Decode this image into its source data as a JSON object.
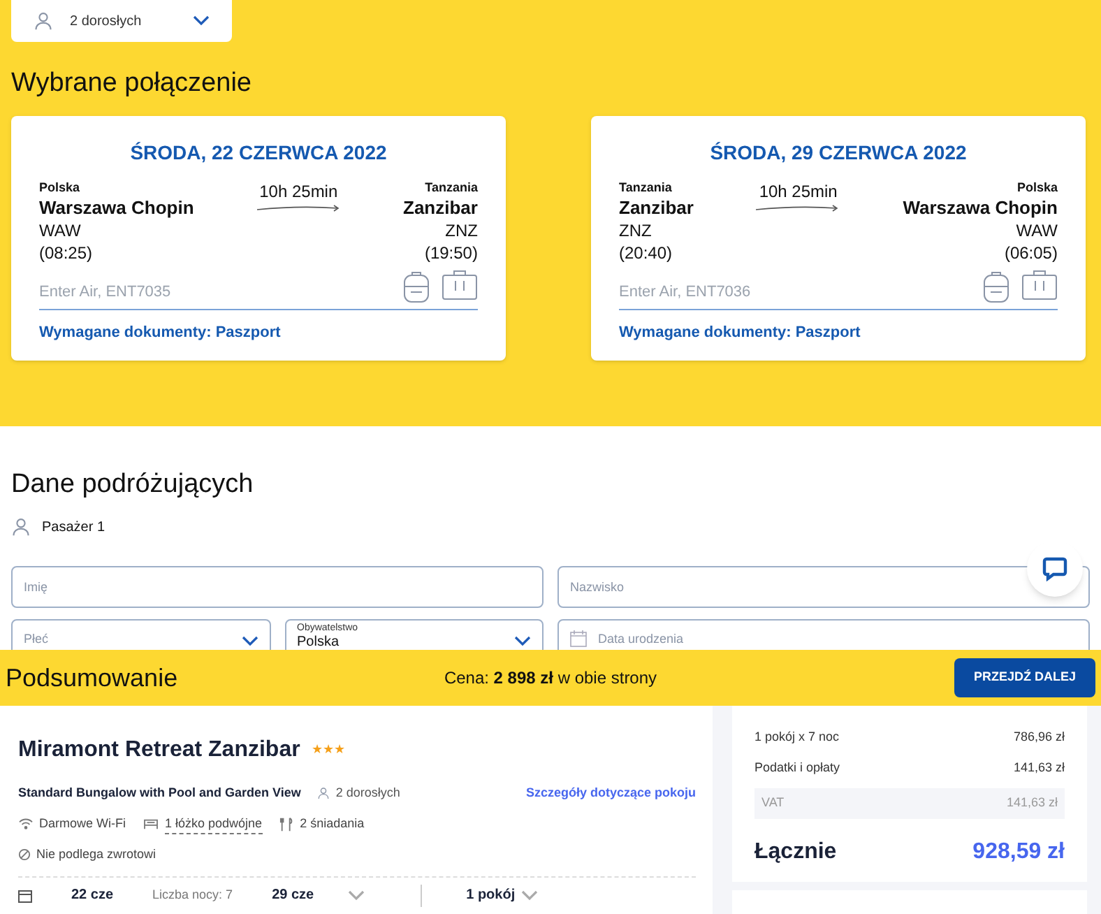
{
  "travellers_select": {
    "value": "2 dorosłych"
  },
  "selected_connection": {
    "title": "Wybrane połączenie",
    "flights": [
      {
        "date": "ŚRODA, 22 CZERWCA 2022",
        "duration": "10h 25min",
        "from": {
          "country": "Polska",
          "city": "Warszawa Chopin",
          "code": "WAW",
          "time": "(08:25)"
        },
        "to": {
          "country": "Tanzania",
          "city": "Zanzibar",
          "code": "ZNZ",
          "time": "(19:50)"
        },
        "carrier": "Enter Air, ENT7035",
        "documents": "Wymagane dokumenty: Paszport"
      },
      {
        "date": "ŚRODA, 29 CZERWCA 2022",
        "duration": "10h 25min",
        "from": {
          "country": "Tanzania",
          "city": "Zanzibar",
          "code": "ZNZ",
          "time": "(20:40)"
        },
        "to": {
          "country": "Polska",
          "city": "Warszawa Chopin",
          "code": "WAW",
          "time": "(06:05)"
        },
        "carrier": "Enter Air, ENT7036",
        "documents": "Wymagane dokumenty: Paszport"
      }
    ]
  },
  "travellers": {
    "title": "Dane podróżujących",
    "passenger": "Pasażer 1",
    "fields": [
      {
        "kind": "text",
        "placeholder": "Imię"
      },
      {
        "kind": "text",
        "placeholder": "Nazwisko"
      },
      {
        "kind": "select",
        "placeholder": "Płeć"
      },
      {
        "kind": "select",
        "label": "Obywatelstwo",
        "value": "Polska"
      },
      {
        "kind": "date",
        "placeholder": "Data urodzenia"
      }
    ]
  },
  "summary_bar": {
    "title": "Podsumowanie",
    "price": "Cena: **2 898 zł** w obie strony",
    "button": "PRZEJDŹ DALEJ"
  },
  "hotel": {
    "name": "Miramont Retreat Zanzibar",
    "stars": 3,
    "room": "Standard Bungalow with Pool and Garden View",
    "guests": "2 dorosłych",
    "room_link": "Szczegóły dotyczące pokoju",
    "amenities": [
      {
        "kind": "wifi",
        "text": "Darmowe Wi-Fi"
      },
      {
        "kind": "bed",
        "text": "1 łóżko podwójne"
      },
      {
        "kind": "meal",
        "text": "2 śniadania"
      }
    ],
    "refund": "Nie podlega zwrotowi",
    "check_in": "22 cze",
    "nights": "Liczba nocy: 7",
    "check_out": "29 cze",
    "rooms": "1 pokój"
  },
  "price_breakdown": {
    "rows": [
      {
        "kind": "line",
        "label": "1 pokój x 7 noc",
        "value": "786,96 zł"
      },
      {
        "kind": "line",
        "label": "Podatki i opłaty",
        "value": "141,63 zł"
      },
      {
        "kind": "sub",
        "label": "VAT",
        "value": "141,63 zł"
      }
    ],
    "total_label": "Łącznie",
    "total": "928,59 zł"
  }
}
